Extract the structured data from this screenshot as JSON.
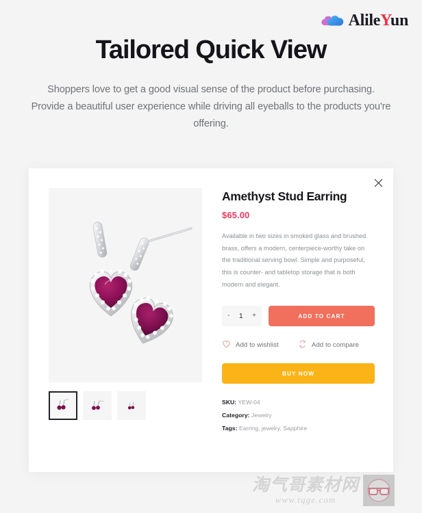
{
  "brand": {
    "name_part1": "Alile",
    "name_accent": "Y",
    "name_part2": "un",
    "logo_icon": "cloud-icon",
    "accent_color": "#e8334a"
  },
  "hero": {
    "title": "Tailored Quick View",
    "subtitle": "Shoppers love to get a good visual sense of the product before purchasing. Provide a beautiful user experience while driving all eyeballs to the products you're offering."
  },
  "quick_view": {
    "close_icon": "close-icon",
    "gallery": {
      "main_image_alt": "amethyst-heart-drop-earrings",
      "thumbnails": [
        {
          "alt": "earrings-view-1",
          "active": true
        },
        {
          "alt": "earrings-view-2",
          "active": false
        },
        {
          "alt": "earrings-view-3",
          "active": false
        }
      ]
    },
    "product": {
      "title": "Amethyst Stud Earring",
      "price": "$65.00",
      "price_color": "#f2385a",
      "description": "Available in two sizes in smoked glass and brushed brass, offers a modern, centerpiece-worthy take on the traditional serving bowl. Simple and purposeful, this is counter- and tabletop storage that is both modern and elegant.",
      "quantity": {
        "decrement_label": "-",
        "value": "1",
        "increment_label": "+"
      },
      "add_to_cart_label": "ADD TO CART",
      "add_to_cart_color": "#f0705d",
      "buy_now_label": "BUY NOW",
      "buy_now_color": "#fbb417",
      "wishlist_label": "Add to wishlist",
      "wishlist_icon": "heart-icon",
      "compare_label": "Add to compare",
      "compare_icon": "compare-arrows-icon",
      "meta": {
        "sku_label": "SKU:",
        "sku_value": "YEW-04",
        "category_label": "Category:",
        "category_value": "Jewelry",
        "tags_label": "Tags:",
        "tags_value": "Earring, jewelry, Sapphire"
      }
    }
  },
  "watermark": {
    "cn_text": "淘气哥素材网",
    "url_text": "www.tqge.com",
    "badge_icon": "glasses-face-icon"
  }
}
